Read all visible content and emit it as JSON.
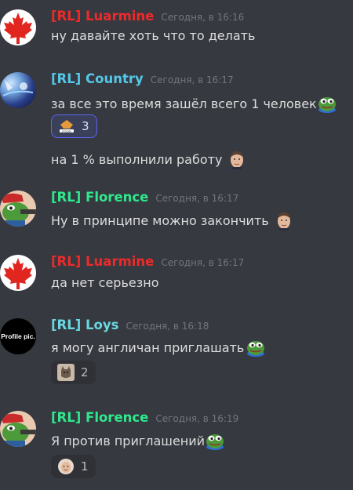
{
  "colors": {
    "background": "#36393f",
    "luarmine": "#ed2b2b",
    "country": "#54c8e8",
    "florence": "#2ee88e",
    "loys": "#6ad7e0",
    "timestamp": "#72767d",
    "reaction_active_border": "#5865f2"
  },
  "messages": [
    {
      "author": "[RL] Luarmine",
      "timestamp": "Сегодня, в 16:16",
      "lines": [
        "ну давайте хоть что то делать"
      ],
      "avatar": "canada-leaf-avatar"
    },
    {
      "author": "[RL] Country",
      "timestamp": "Сегодня, в 16:17",
      "lines": [
        "за все это время зашёл всего 1 человек",
        "на 1 % выполнили работу"
      ],
      "emojis": [
        "pepe-emoji",
        "face-emoji"
      ],
      "reaction": {
        "label": "утошок",
        "count": "3"
      },
      "avatar": "space-avatar"
    },
    {
      "author": "[RL] Florence",
      "timestamp": "Сегодня, в 16:17",
      "lines": [
        "Ну в принципе можно закончить"
      ],
      "emojis": [
        "face-emoji"
      ],
      "avatar": "pepe-gun-avatar"
    },
    {
      "author": "[RL] Luarmine",
      "timestamp": "Сегодня, в 16:17",
      "lines": [
        "да нет серьезно"
      ],
      "avatar": "canada-leaf-avatar"
    },
    {
      "author": "[RL] Loys",
      "timestamp": "Сегодня, в 16:18",
      "lines": [
        "я могу англичан приглашать"
      ],
      "emojis": [
        "pepe-emoji"
      ],
      "reaction": {
        "count": "2"
      },
      "avatar": "profile-pic-avatar",
      "avatar_text": "Profile pic."
    },
    {
      "author": "[RL] Florence",
      "timestamp": "Сегодня, в 16:19",
      "lines": [
        "Я против приглашений"
      ],
      "emojis": [
        "pepe-emoji"
      ],
      "reaction": {
        "count": "1"
      },
      "avatar": "pepe-gun-avatar"
    }
  ]
}
